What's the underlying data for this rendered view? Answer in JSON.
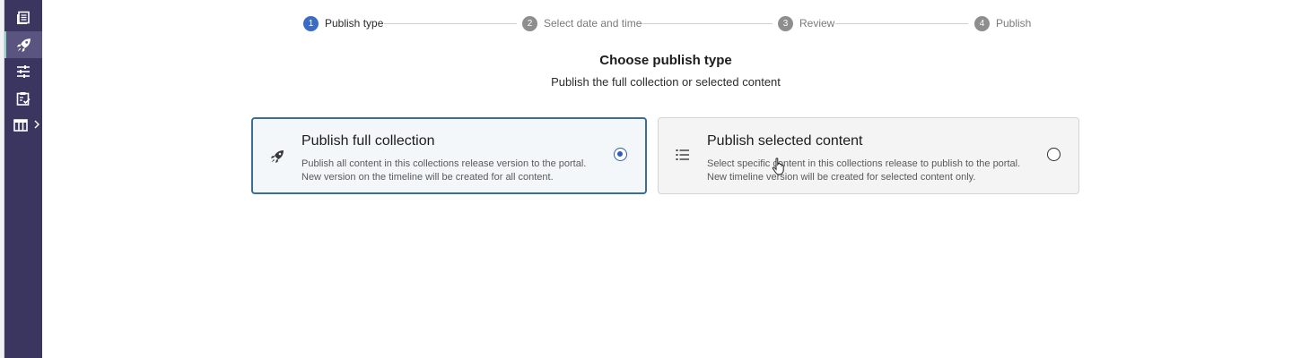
{
  "sidebar": {
    "items": [
      {
        "icon": "notes-list-icon"
      },
      {
        "icon": "rocket-icon",
        "active": true
      },
      {
        "icon": "sliders-icon"
      },
      {
        "icon": "clipboard-check-icon"
      },
      {
        "icon": "table-layout-icon",
        "expand": "chevron-right-icon"
      }
    ]
  },
  "stepper": {
    "steps": [
      {
        "number": "1",
        "label": "Publish type",
        "active": true
      },
      {
        "number": "2",
        "label": "Select date and time"
      },
      {
        "number": "3",
        "label": "Review"
      },
      {
        "number": "4",
        "label": "Publish"
      }
    ]
  },
  "main": {
    "title": "Choose publish type",
    "subtitle": "Publish the full collection or selected content"
  },
  "options": [
    {
      "title": "Publish full collection",
      "desc_line1": "Publish all content in this collections release version to the portal.",
      "desc_line2": "New version on the timeline will be created for all content.",
      "icon": "rocket-icon",
      "selected": true
    },
    {
      "title": "Publish selected content",
      "desc_line1": "Select specific content in this collections release to publish to the portal.",
      "desc_line2": "New timeline version will be created for selected content only.",
      "icon": "list-icon",
      "selected": false
    }
  ],
  "colors": {
    "sidebar_bg": "#3b3660",
    "accent": "#3a6cc4",
    "selected_border": "#3b6e96"
  }
}
